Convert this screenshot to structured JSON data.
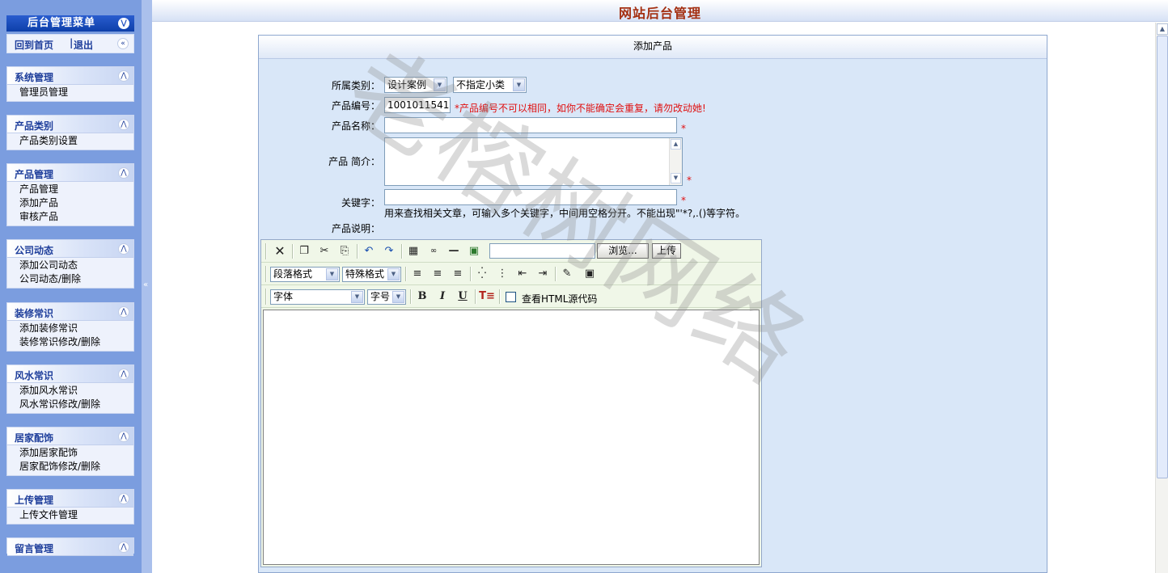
{
  "sidebar": {
    "title": "后台管理菜单",
    "home": "回到首页",
    "sep": "|",
    "logout": "退出",
    "groups": [
      {
        "title": "系统管理",
        "items": [
          "管理员管理"
        ]
      },
      {
        "title": "产品类别",
        "items": [
          "产品类别设置"
        ]
      },
      {
        "title": "产品管理",
        "items": [
          "产品管理",
          "添加产品",
          "审核产品"
        ]
      },
      {
        "title": "公司动态",
        "items": [
          "添加公司动态",
          "公司动态/删除"
        ]
      },
      {
        "title": "装修常识",
        "items": [
          "添加装修常识",
          "装修常识修改/删除"
        ]
      },
      {
        "title": "风水常识",
        "items": [
          "添加风水常识",
          "风水常识修改/删除"
        ]
      },
      {
        "title": "居家配饰",
        "items": [
          "添加居家配饰",
          "居家配饰修改/删除"
        ]
      },
      {
        "title": "上传管理",
        "items": [
          "上传文件管理"
        ]
      },
      {
        "title": "留言管理",
        "items": []
      }
    ]
  },
  "header": {
    "title": "网站后台管理"
  },
  "form": {
    "panel_title": "添加产品",
    "category_label": "所属类别：",
    "category_value": "设计案例",
    "subcategory_value": "不指定小类",
    "code_label": "产品编号：",
    "code_value": "1001011541",
    "code_warning": "*产品编号不可以相同，如你不能确定会重复，请勿改动她!",
    "name_label": "产品名称：",
    "intro_label": "产品 简介：",
    "keyword_label": "关键字：",
    "keyword_hint": "用来查找相关文章，可输入多个关键字，中间用空格分开。不能出现\"'*?,.()等字符。",
    "desc_label": "产品说明：",
    "required_mark": "*"
  },
  "editor": {
    "paragraph_format": "段落格式",
    "special_format": "特殊格式",
    "font": "字体",
    "font_size": "字号",
    "browse_label": "浏览...",
    "upload_label": "上传",
    "view_html_label": "查看HTML源代码"
  },
  "watermark": {
    "text": "老榕树网络"
  },
  "icons": {
    "collapse_up": "chevron-up-icon",
    "collapse_left": "chevron-left-icon",
    "bold": "B",
    "italic": "I",
    "underline": "U"
  }
}
